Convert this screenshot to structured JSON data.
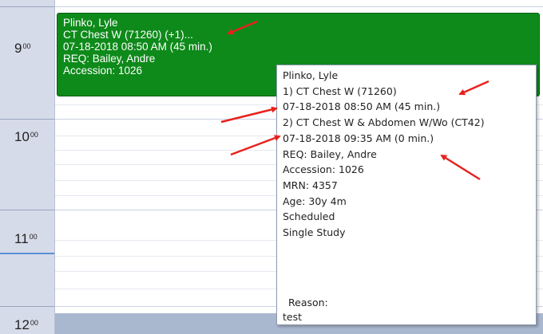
{
  "time_column": {
    "hours": [
      {
        "hour": "9",
        "minutes": "00"
      },
      {
        "hour": "10",
        "minutes": "00"
      },
      {
        "hour": "11",
        "minutes": "00"
      },
      {
        "hour": "12",
        "minutes": "00"
      }
    ]
  },
  "appointment": {
    "patient_name": "Plinko, Lyle",
    "procedure": "CT Chest W (71260) (+1)...",
    "datetime": "07-18-2018 08:50 AM (45 min.)",
    "requester": "REQ:  Bailey, Andre",
    "accession": "Accession: 1026",
    "color": "#0e8a1a"
  },
  "tooltip": {
    "patient_name": "Plinko, Lyle",
    "study1": "1) CT Chest W (71260)",
    "study1_time": "07-18-2018 08:50 AM (45 min.)",
    "study2": "2) CT Chest W & Abdomen W/Wo (CT42)",
    "study2_time": "07-18-2018 09:35 AM (0 min.)",
    "requester": "REQ: Bailey, Andre",
    "accession": "Accession: 1026",
    "mrn": "MRN: 4357",
    "age": "Age: 30y 4m",
    "status": "Scheduled",
    "study_type": "Single Study",
    "reason_label": "Reason:",
    "reason_value": "test"
  },
  "annotation_color": "#e8211c"
}
